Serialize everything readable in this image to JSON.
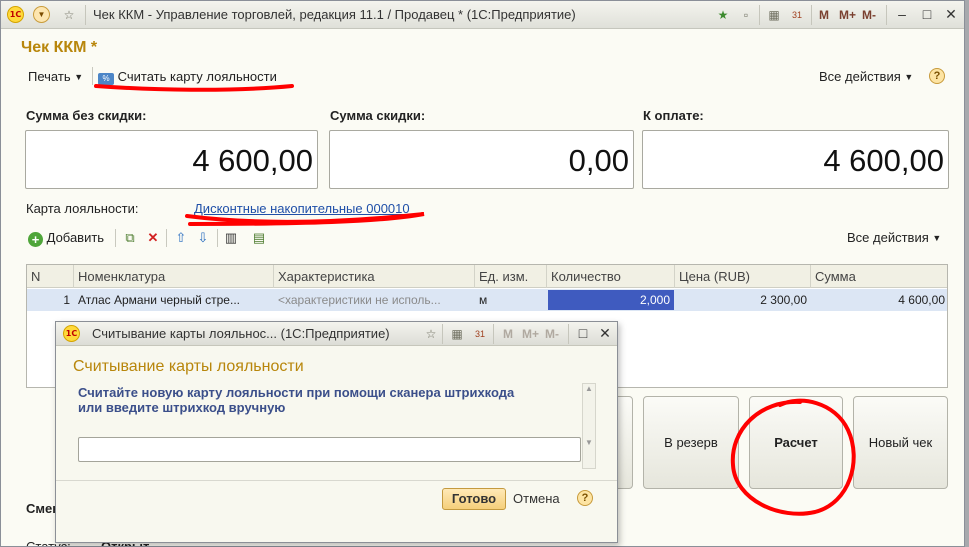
{
  "window": {
    "title": "Чек ККМ - Управление торговлей, редакция 11.1 / Продавец * (1С:Предприятие)",
    "m_buttons": [
      "M",
      "M+",
      "M-"
    ]
  },
  "form": {
    "title": "Чек ККМ *",
    "menu_print": "Печать",
    "menu_read_card": "Считать карту лояльности",
    "menu_all_actions": "Все действия",
    "help": "?"
  },
  "sums": {
    "no_discount_label": "Сумма без скидки:",
    "no_discount_value": "4 600,00",
    "discount_label": "Сумма скидки:",
    "discount_value": "0,00",
    "to_pay_label": "К оплате:",
    "to_pay_value": "4 600,00"
  },
  "loyalty": {
    "label": "Карта лояльности:",
    "link": "Дисконтные накопительные 000010"
  },
  "table_toolbar": {
    "add_label": "Добавить",
    "all_actions": "Все действия"
  },
  "table": {
    "columns": [
      "N",
      "Номенклатура",
      "Характеристика",
      "Ед. изм.",
      "Количество",
      "Цена (RUB)",
      "Сумма"
    ],
    "rows": [
      {
        "n": "1",
        "item": "Атлас Армани черный стре...",
        "characteristic": "<характеристики не исполь...",
        "unit": "м",
        "qty": "2,000",
        "price": "2 300,00",
        "sum": "4 600,00"
      }
    ]
  },
  "actions": {
    "reserve": "В резерв",
    "calc": "Расчет",
    "new_receipt": "Новый чек"
  },
  "bottom": {
    "shift_label": "Смен",
    "status_label": "Статус:",
    "status_value": "Открыт"
  },
  "dialog": {
    "window_title": "Считывание карты лояльнос... (1С:Предприятие)",
    "m_buttons": [
      "M",
      "M+",
      "M-"
    ],
    "heading": "Считывание карты лояльности",
    "instruction": "Считайте новую карту лояльности при помощи сканера штрихкода или введите штрихкод вручную",
    "input_value": "",
    "ok_label": "Готово",
    "cancel_label": "Отмена",
    "help": "?"
  },
  "colors": {
    "accent": "#b8860b",
    "link": "#1f4fa8",
    "annotation": "#ff0000",
    "selected_cell": "#3f5bbf"
  }
}
